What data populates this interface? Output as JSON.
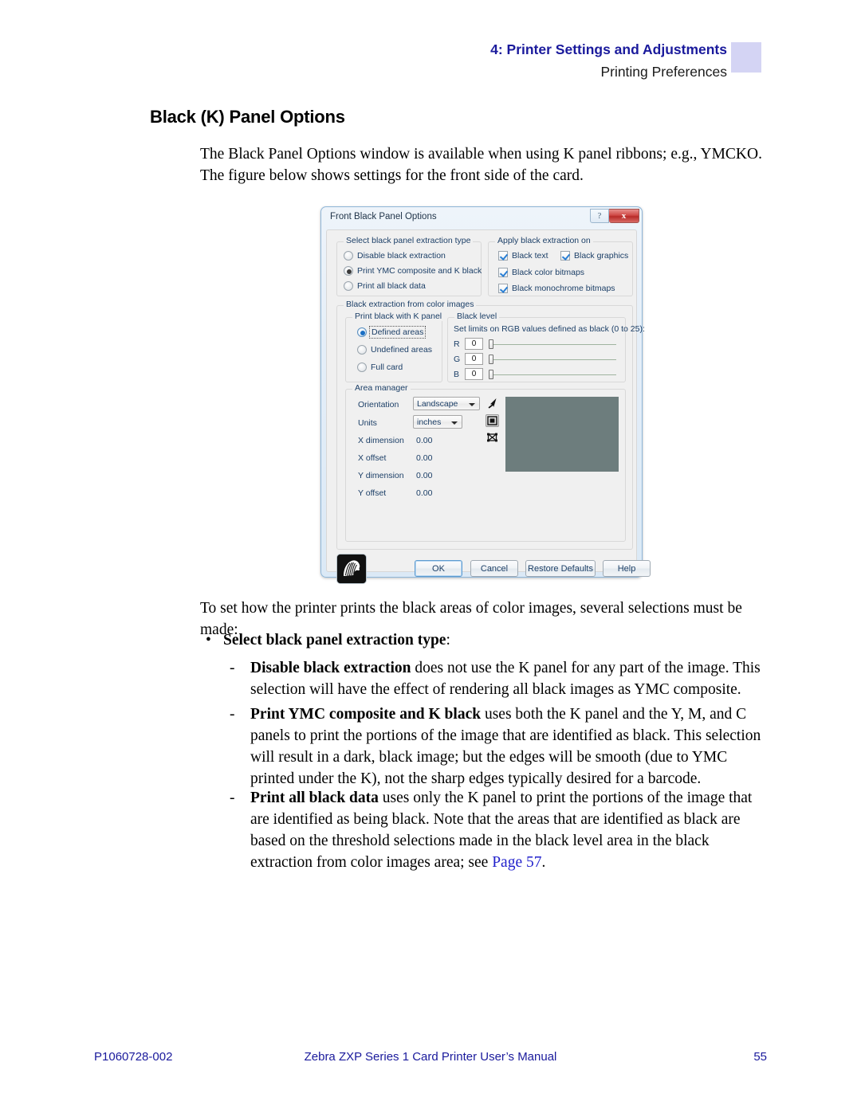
{
  "header": {
    "chapter": "4: Printer Settings and Adjustments",
    "subtitle": "Printing Preferences",
    "swatch_color": "#d4d4f4"
  },
  "page": {
    "heading": "Black (K) Panel Options",
    "intro": "The Black Panel Options window is available when using K panel ribbons; e.g., YMCKO. The figure below shows settings for the front side of the card.",
    "lead": "To set how the printer prints the black areas of color images, several selections must be made:",
    "bullet_marker": "•",
    "dash_marker": "-",
    "bullet1_bold": "Select black panel extraction type",
    "bullet1_tail": ":",
    "dash1_bold": "Disable black extraction",
    "dash1_tail": " does not use the K panel for any part of the image. This selection will have the effect of rendering all black images as YMC composite.",
    "dash2_bold": "Print YMC composite and K black",
    "dash2_tail": " uses both the K panel and the Y, M, and C panels to print the portions of the image that are identified as black. This selection will result in a dark, black image; but the edges will be smooth (due to YMC printed under the K), not the sharp edges typically desired for a barcode.",
    "dash3_bold": "Print all black data",
    "dash3_tail_a": " uses only the K panel to print the portions of the image that are identified as being black. Note that the areas that are identified as black are based on the threshold selections made in the black level area in the black extraction from color images area; see ",
    "dash3_link": "Page 57",
    "dash3_tail_b": "."
  },
  "footer": {
    "left": "P1060728-002",
    "center": "Zebra ZXP Series 1 Card Printer User’s Manual",
    "right": "55",
    "color": "#1a1a9c"
  },
  "dialog": {
    "title": "Front Black Panel Options",
    "titlebar_help_glyph": "?",
    "titlebar_close_glyph": "x",
    "extraction_type": {
      "legend": "Select black panel extraction type",
      "options": [
        {
          "label": "Disable black extraction",
          "selected": false
        },
        {
          "label": "Print YMC composite and K black",
          "selected": true
        },
        {
          "label": "Print all black data",
          "selected": false
        }
      ]
    },
    "apply_on": {
      "legend": "Apply black extraction on",
      "options": [
        {
          "label": "Black text",
          "checked": true
        },
        {
          "label": "Black graphics",
          "checked": true
        },
        {
          "label": "Black color bitmaps",
          "checked": true
        },
        {
          "label": "Black monochrome bitmaps",
          "checked": true
        }
      ]
    },
    "black_extraction": {
      "legend": "Black extraction from color images",
      "k_panel": {
        "legend": "Print black with K panel",
        "options": [
          {
            "label": "Defined areas",
            "selected": true,
            "focused": true
          },
          {
            "label": "Undefined areas",
            "selected": false,
            "focused": false
          },
          {
            "label": "Full card",
            "selected": false,
            "focused": false
          }
        ]
      },
      "black_level": {
        "legend": "Black level",
        "instruction": "Set limits on RGB values defined as black (0 to 25):",
        "channels": [
          {
            "letter": "R",
            "value": "0"
          },
          {
            "letter": "G",
            "value": "0"
          },
          {
            "letter": "B",
            "value": "0"
          }
        ]
      }
    },
    "area_manager": {
      "legend": "Area manager",
      "orientation_label": "Orientation",
      "orientation_value": "Landscape",
      "units_label": "Units",
      "units_value": "inches",
      "fields": [
        {
          "label": "X dimension",
          "value": "0.00"
        },
        {
          "label": "X offset",
          "value": "0.00"
        },
        {
          "label": "Y dimension",
          "value": "0.00"
        },
        {
          "label": "Y offset",
          "value": "0.00"
        }
      ],
      "tools": [
        {
          "name": "pointer-tool",
          "pressed": false
        },
        {
          "name": "rectangle-tool",
          "pressed": true
        },
        {
          "name": "delete-area-tool",
          "pressed": false
        }
      ],
      "preview_color": "#6d7d7d"
    },
    "buttons": [
      {
        "name": "ok",
        "label": "OK",
        "default": true
      },
      {
        "name": "cancel",
        "label": "Cancel",
        "default": false
      },
      {
        "name": "restore-defaults",
        "label": "Restore Defaults",
        "default": false,
        "accel": "R"
      },
      {
        "name": "help",
        "label": "Help",
        "default": false
      }
    ]
  }
}
